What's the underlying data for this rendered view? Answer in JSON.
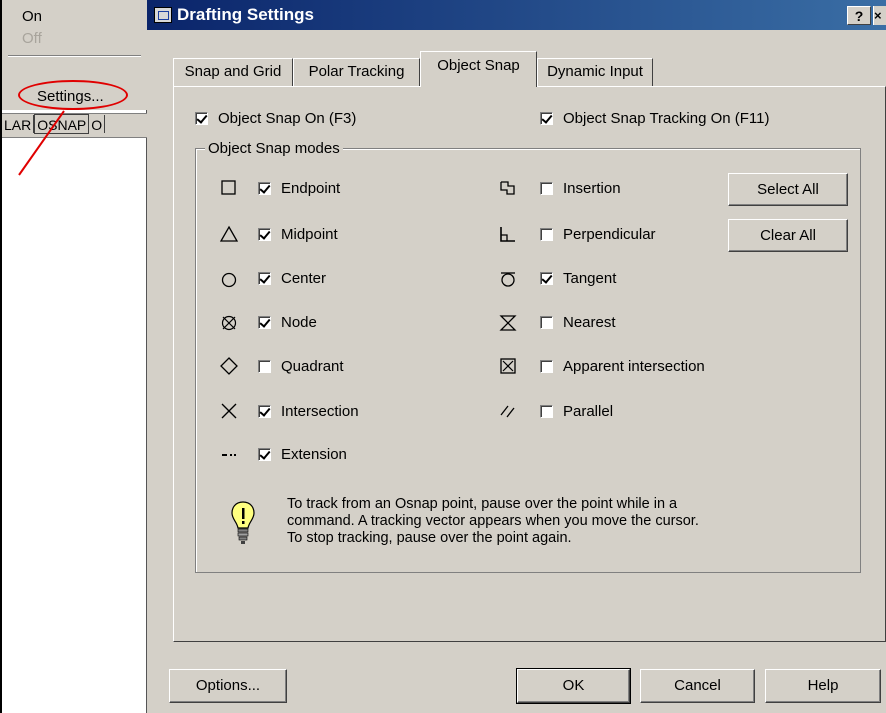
{
  "context_menu": {
    "items": [
      {
        "label": "On",
        "enabled": true
      },
      {
        "label": "Off",
        "enabled": false
      },
      {
        "label": "Settings...",
        "enabled": true,
        "highlighted_by_annotation": true
      }
    ],
    "annotation_color": "#e00000"
  },
  "status_bar": {
    "buttons": [
      "LAR",
      "OSNAP",
      "O"
    ]
  },
  "dialog": {
    "title": "Drafting Settings",
    "title_buttons": {
      "help": "?",
      "close": "×"
    },
    "tabs": [
      {
        "label": "Snap and Grid",
        "active": false
      },
      {
        "label": "Polar Tracking",
        "active": false
      },
      {
        "label": "Object Snap",
        "active": true
      },
      {
        "label": "Dynamic Input",
        "active": false
      }
    ],
    "object_snap_on": {
      "label": "Object Snap On (F3)",
      "checked": true
    },
    "object_snap_tracking_on": {
      "label": "Object Snap Tracking On (F11)",
      "checked": true
    },
    "modes_group_title": "Object Snap modes",
    "modes_left": [
      {
        "label": "Endpoint",
        "checked": true,
        "icon": "endpoint-square-icon"
      },
      {
        "label": "Midpoint",
        "checked": true,
        "icon": "midpoint-triangle-icon"
      },
      {
        "label": "Center",
        "checked": true,
        "icon": "center-circle-icon"
      },
      {
        "label": "Node",
        "checked": true,
        "icon": "node-icon"
      },
      {
        "label": "Quadrant",
        "checked": false,
        "icon": "quadrant-diamond-icon"
      },
      {
        "label": "Intersection",
        "checked": true,
        "icon": "intersection-x-icon"
      },
      {
        "label": "Extension",
        "checked": true,
        "icon": "extension-dashes-icon"
      }
    ],
    "modes_right": [
      {
        "label": "Insertion",
        "checked": false,
        "icon": "insertion-icon"
      },
      {
        "label": "Perpendicular",
        "checked": false,
        "icon": "perpendicular-icon"
      },
      {
        "label": "Tangent",
        "checked": true,
        "icon": "tangent-icon"
      },
      {
        "label": "Nearest",
        "checked": false,
        "icon": "nearest-hourglass-icon"
      },
      {
        "label": "Apparent intersection",
        "checked": false,
        "icon": "apparent-intersection-icon"
      },
      {
        "label": "Parallel",
        "checked": false,
        "icon": "parallel-icon"
      }
    ],
    "select_all_label": "Select All",
    "clear_all_label": "Clear All",
    "tip": {
      "lines": [
        "To track from an Osnap point, pause over the point while in a",
        "command.  A tracking vector appears when you move the cursor.",
        "To stop tracking, pause over the point again."
      ],
      "icon": "lightbulb-icon"
    },
    "footer": {
      "options_label": "Options...",
      "ok_label": "OK",
      "cancel_label": "Cancel",
      "help_label": "Help"
    }
  }
}
